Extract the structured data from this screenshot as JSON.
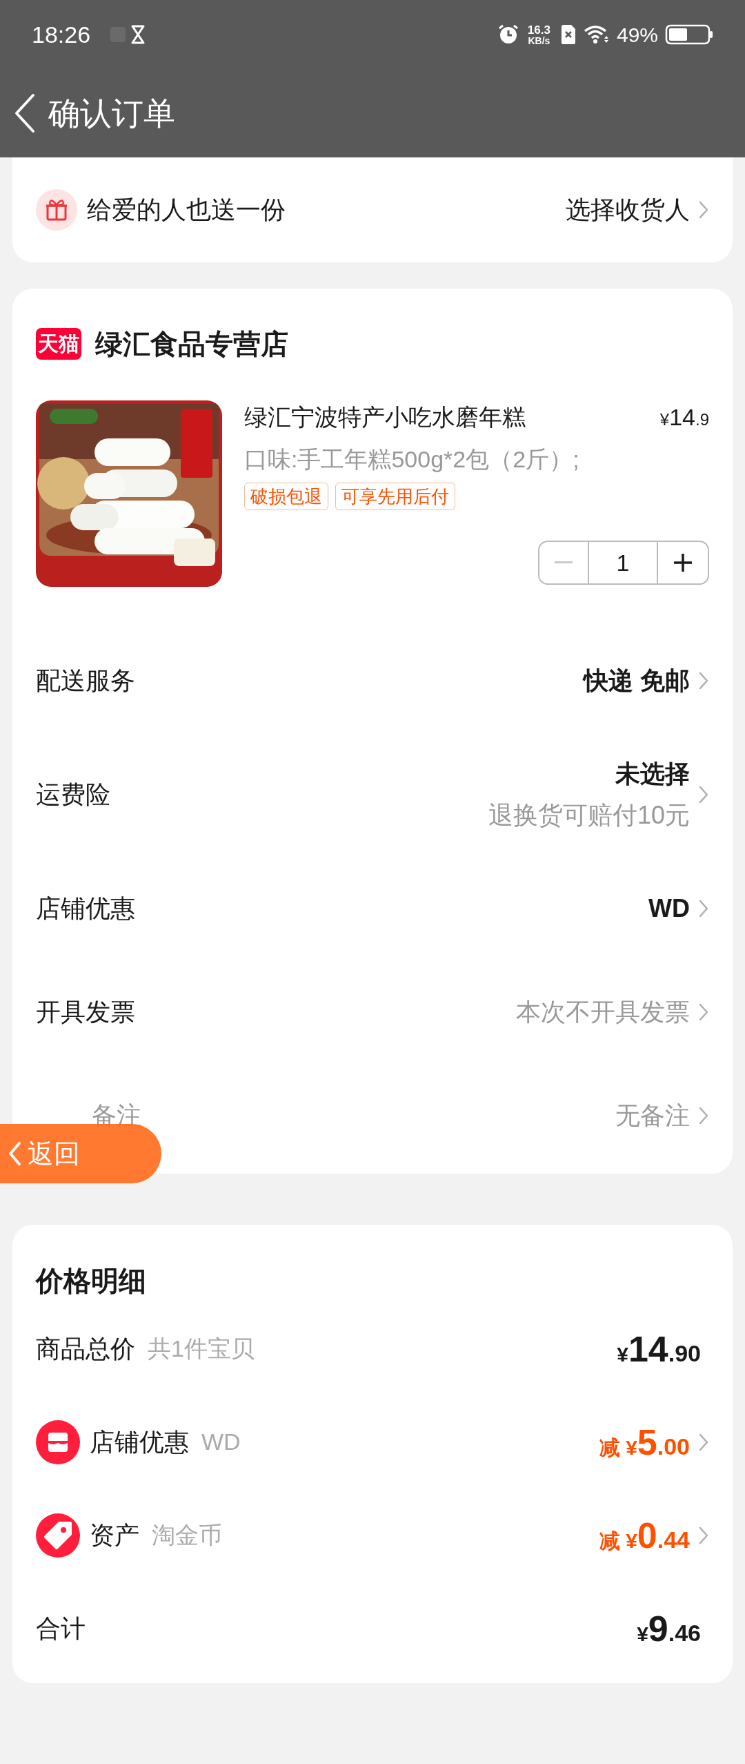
{
  "status_bar": {
    "time": "18:26",
    "net_speed": "16.3",
    "net_unit": "KB/s",
    "battery": "49%"
  },
  "header": {
    "title": "确认订单"
  },
  "gift": {
    "label": "给爱的人也送一份",
    "action": "选择收货人"
  },
  "store": {
    "badge": "天猫",
    "name": "绿汇食品专营店"
  },
  "product": {
    "title": "绿汇宁波特产小吃水磨年糕",
    "price_symbol": "¥",
    "price_int": "14",
    "price_dec": ".9",
    "spec": "口味:手工年糕500g*2包（2斤）;",
    "tags": [
      "破损包退",
      "可享先用后付"
    ],
    "quantity": "1",
    "decrease_disabled": true
  },
  "options": [
    {
      "label": "配送服务",
      "value": "快递 免邮",
      "muted": false
    },
    {
      "label": "运费险",
      "value": "未选择",
      "note": "退换货可赔付10元",
      "muted": false
    },
    {
      "label": "店铺优惠",
      "value": "WD",
      "muted": false
    },
    {
      "label": "开具发票",
      "value": "本次不开具发票",
      "muted": true
    },
    {
      "label": "备注",
      "value": "无备注",
      "muted": true
    }
  ],
  "floating_back": {
    "label": "返回"
  },
  "price_details": {
    "title": "价格明细",
    "rows": [
      {
        "kind": "plain",
        "label": "商品总价",
        "note": "共1件宝贝",
        "symbol": "¥",
        "amount_int": "14",
        "amount_dec": ".90"
      },
      {
        "kind": "store",
        "label": "店铺优惠",
        "note": "WD",
        "prefix": "减",
        "symbol": "¥",
        "amount_int": "5",
        "amount_dec": ".00"
      },
      {
        "kind": "asset",
        "label": "资产",
        "note": "淘金币",
        "prefix": "减",
        "symbol": "¥",
        "amount_int": "0",
        "amount_dec": ".44"
      },
      {
        "kind": "total",
        "label": "合计",
        "symbol": "¥",
        "amount_int": "9",
        "amount_dec": ".46"
      }
    ]
  }
}
